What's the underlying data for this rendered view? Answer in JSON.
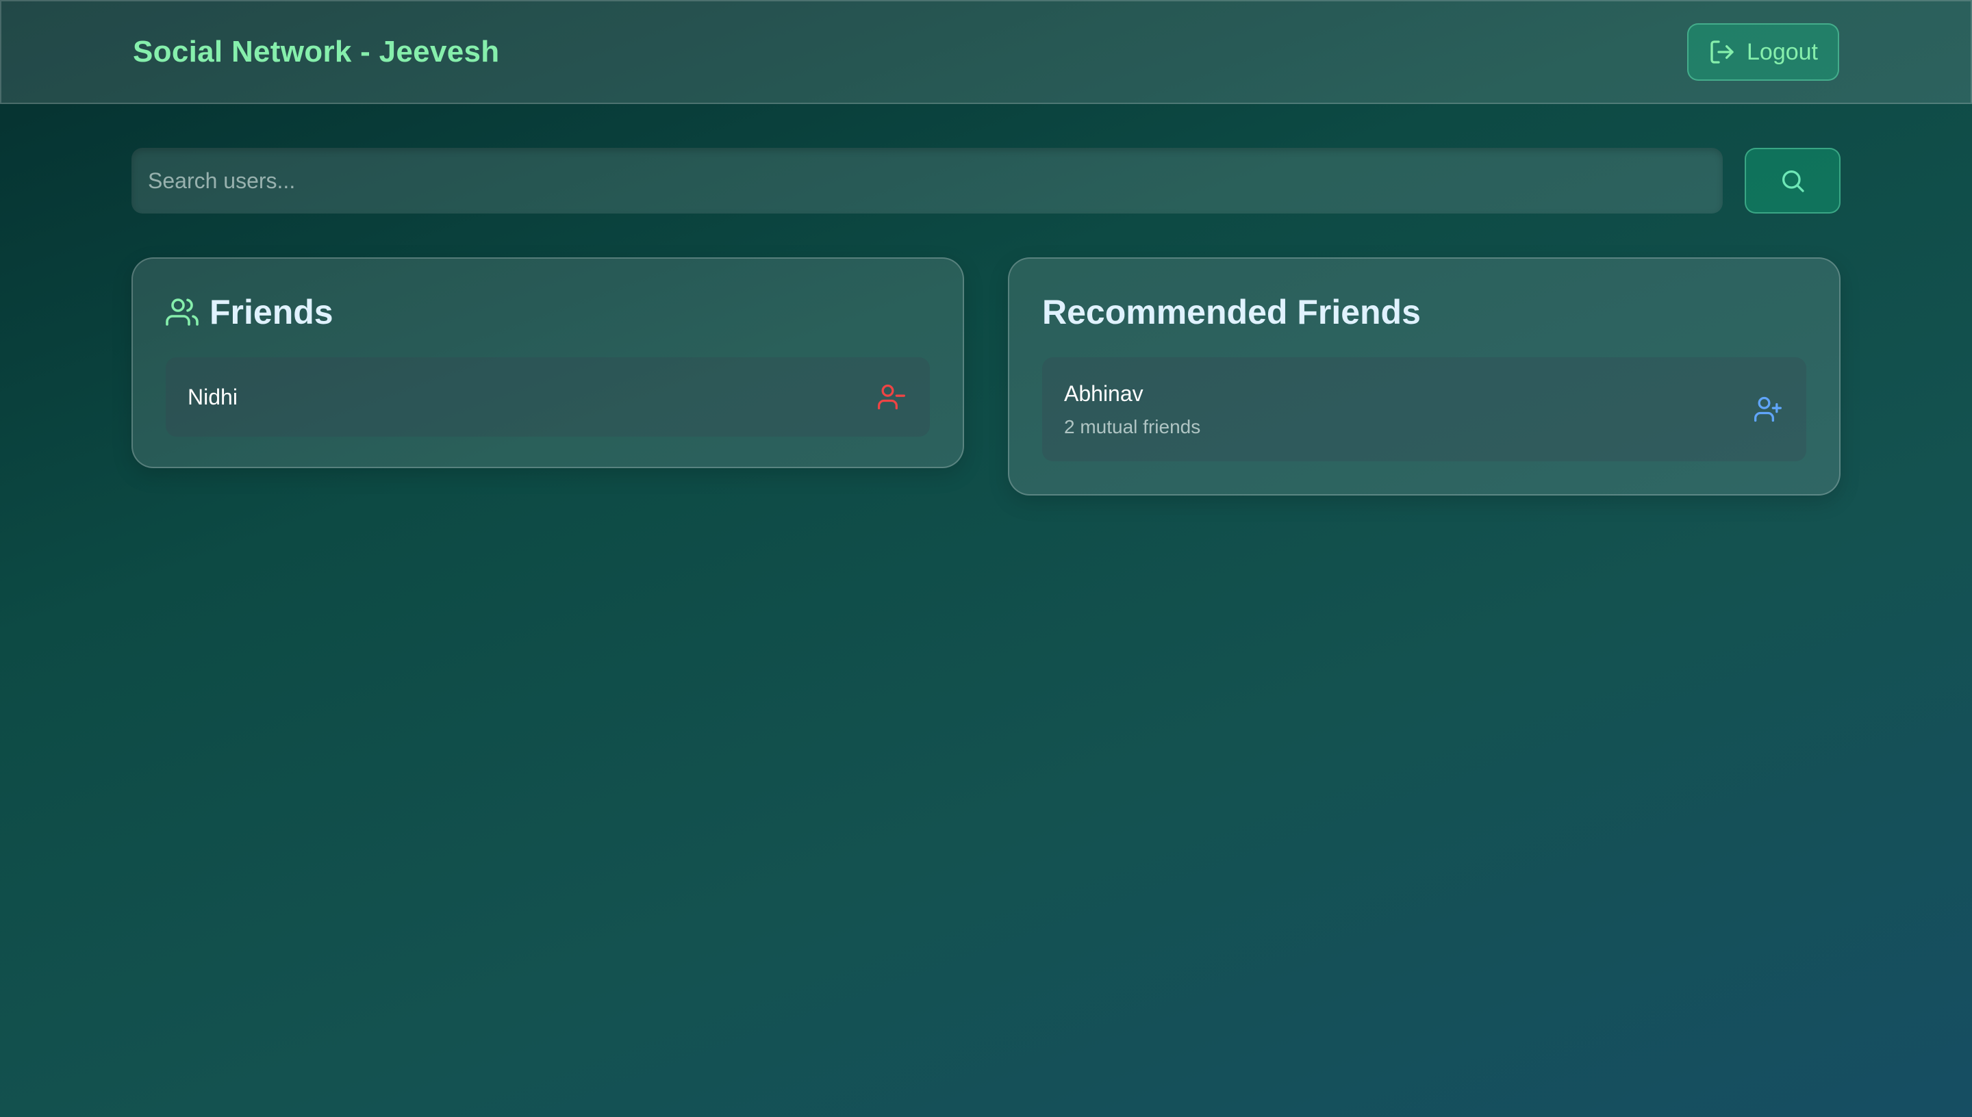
{
  "header": {
    "title": "Social Network - Jeevesh",
    "logout_label": "Logout",
    "logout_icon": "logout-icon"
  },
  "search": {
    "placeholder": "Search users...",
    "value": "",
    "button_icon": "search-icon"
  },
  "friends": {
    "title": "Friends",
    "icon": "users-icon",
    "items": [
      {
        "name": "Nidhi",
        "action_icon": "user-minus-icon"
      }
    ]
  },
  "recommended": {
    "title": "Recommended Friends",
    "items": [
      {
        "name": "Abhinav",
        "mutual": "2 mutual friends",
        "action_icon": "user-plus-icon"
      }
    ]
  },
  "colors": {
    "accent_green": "#86efac",
    "remove_red": "#ef4444",
    "add_blue": "#60a5fa",
    "title_text": "#e0f2fe"
  }
}
